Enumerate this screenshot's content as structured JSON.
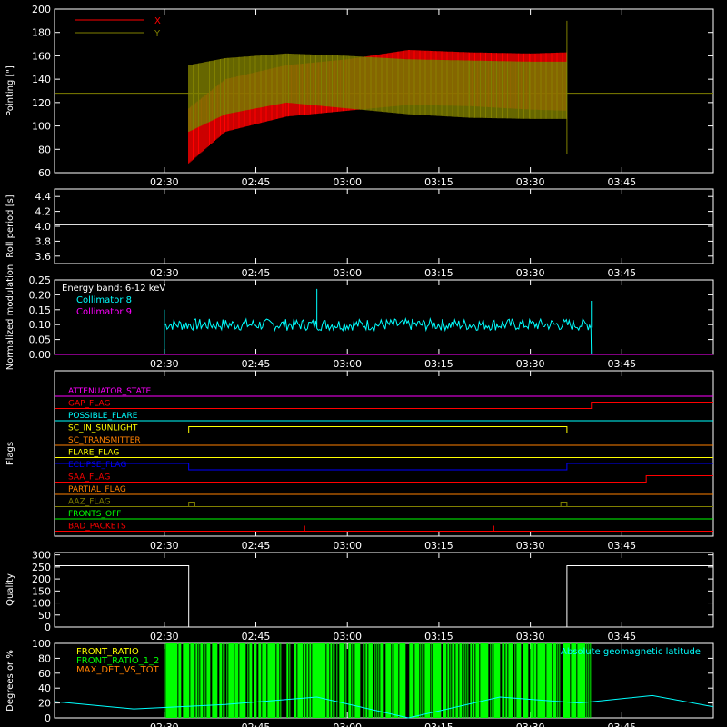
{
  "x_axis": {
    "unit": "time",
    "range": [
      "02:12",
      "04:00"
    ],
    "ticks": [
      "02:30",
      "02:45",
      "03:00",
      "03:15",
      "03:30",
      "03:45"
    ]
  },
  "colors": {
    "background": "#000000",
    "axes": "#ffffff",
    "x_series": "#ff0000",
    "y_series": "#808000",
    "collimator8": "#00ffff",
    "collimator9": "#ff00ff",
    "quality": "#ffffff",
    "front_ratio": "#00ff00",
    "latitude": "#00ffff"
  },
  "chart_data": [
    {
      "id": "pointing",
      "type": "line",
      "ylabel": "Pointing [\"]",
      "ylim": [
        60,
        200
      ],
      "yticks": [
        "60",
        "80",
        "100",
        "120",
        "140",
        "160",
        "180",
        "200"
      ],
      "series": [
        {
          "name": "X",
          "color": "#ff0000",
          "x": [
            "02:34",
            "02:40",
            "02:50",
            "03:00",
            "03:10",
            "03:20",
            "03:30",
            "03:36"
          ],
          "y_upper": [
            115,
            140,
            152,
            157,
            165,
            163,
            162,
            163
          ],
          "y_lower": [
            68,
            95,
            108,
            113,
            118,
            117,
            114,
            113
          ]
        },
        {
          "name": "Y",
          "color": "#808000",
          "x": [
            "02:34",
            "02:40",
            "02:50",
            "03:00",
            "03:10",
            "03:20",
            "03:30",
            "03:36"
          ],
          "y_upper": [
            152,
            158,
            162,
            160,
            157,
            156,
            155,
            155
          ],
          "y_lower": [
            95,
            110,
            120,
            115,
            110,
            107,
            106,
            106
          ],
          "baseline": 128
        }
      ]
    },
    {
      "id": "roll",
      "type": "line",
      "ylabel": "Roll period [s]",
      "ylim": [
        3.5,
        4.5
      ],
      "yticks": [
        "3.6",
        "3.8",
        "4.0",
        "4.2",
        "4.4"
      ],
      "series": [
        {
          "name": "",
          "color": "#ffffff",
          "x": [
            "02:12",
            "04:00"
          ],
          "y": [
            4.02,
            4.02
          ]
        }
      ]
    },
    {
      "id": "modulation",
      "type": "line",
      "ylabel": "Normalized modulation",
      "ylim": [
        0,
        0.25
      ],
      "yticks": [
        "0.00",
        "0.05",
        "0.10",
        "0.15",
        "0.20",
        "0.25"
      ],
      "annotation": "Energy band: 6-12 keV",
      "series": [
        {
          "name": "Collimator 8",
          "color": "#00ffff",
          "x_range": [
            "02:30",
            "03:40"
          ],
          "mean": 0.1,
          "spikes": [
            {
              "x": "02:55",
              "y": 0.22
            },
            {
              "x": "03:40",
              "y": 0.18
            }
          ]
        },
        {
          "name": "Collimator 9",
          "color": "#ff00ff",
          "x": [
            "02:12",
            "04:00"
          ],
          "y": [
            0,
            0
          ]
        }
      ]
    },
    {
      "id": "flags",
      "type": "line",
      "ylabel": "Flags",
      "flags": [
        {
          "name": "ATTENUATOR_STATE",
          "color": "#ff00ff",
          "transitions": []
        },
        {
          "name": "GAP_FLAG",
          "color": "#ff0000",
          "transitions": [
            {
              "x": "03:40",
              "state": 1
            }
          ]
        },
        {
          "name": "POSSIBLE_FLARE",
          "color": "#00ffff",
          "transitions": []
        },
        {
          "name": "SC_IN_SUNLIGHT",
          "color": "#ffff00",
          "transitions": [
            {
              "x": "02:34",
              "state": 1
            },
            {
              "x": "03:36",
              "state": 0
            }
          ]
        },
        {
          "name": "SC_TRANSMITTER",
          "color": "#ff8000",
          "transitions": []
        },
        {
          "name": "FLARE_FLAG",
          "color": "#ffff00",
          "transitions": []
        },
        {
          "name": "ECLIPSE_FLAG",
          "color": "#0000ff",
          "transitions": [
            {
              "x": "02:34",
              "state": 0
            },
            {
              "x": "03:36",
              "state": 1
            }
          ],
          "initial": 1
        },
        {
          "name": "SAA_FLAG",
          "color": "#ff0000",
          "transitions": [
            {
              "x": "03:49",
              "state": 1
            }
          ]
        },
        {
          "name": "PARTIAL_FLAG",
          "color": "#ff8000",
          "transitions": []
        },
        {
          "name": "AAZ_FLAG",
          "color": "#808000",
          "transitions": []
        },
        {
          "name": "FRONTS_OFF",
          "color": "#00ff00",
          "transitions": []
        },
        {
          "name": "BAD_PACKETS",
          "color": "#ff0000",
          "transitions": []
        }
      ]
    },
    {
      "id": "quality",
      "type": "line",
      "ylabel": "Quality",
      "ylim": [
        0,
        310
      ],
      "yticks": [
        "0",
        "50",
        "100",
        "150",
        "200",
        "250",
        "300"
      ],
      "series": [
        {
          "name": "",
          "color": "#ffffff",
          "x": [
            "02:12",
            "02:34",
            "02:34",
            "03:36",
            "03:36",
            "04:00"
          ],
          "y": [
            255,
            255,
            0,
            0,
            255,
            255
          ]
        }
      ]
    },
    {
      "id": "front_ratio",
      "type": "bar",
      "ylabel": "Degrees or %",
      "ylim": [
        0,
        100
      ],
      "yticks": [
        "0",
        "20",
        "40",
        "60",
        "80",
        "100"
      ],
      "legend": [
        "FRONT_RATIO",
        "FRONT_RATIO_1_2",
        "MAX_DET_VS_TOT"
      ],
      "legend_right": "Absolute geomagnetic latitude",
      "series": [
        {
          "name": "FRONT_RATIO",
          "color": "#00ff00",
          "x_range": [
            "02:30",
            "03:40"
          ],
          "y": 100
        },
        {
          "name": "Absolute geomagnetic latitude",
          "color": "#00ffff",
          "x": [
            "02:12",
            "02:25",
            "02:40",
            "02:55",
            "03:10",
            "03:25",
            "03:38",
            "03:50",
            "04:00"
          ],
          "y": [
            22,
            12,
            18,
            28,
            0,
            28,
            20,
            30,
            15
          ]
        }
      ]
    }
  ]
}
